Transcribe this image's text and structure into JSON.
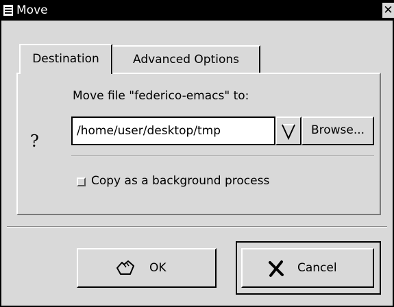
{
  "window": {
    "title": "Move"
  },
  "tabs": [
    {
      "label": "Destination"
    },
    {
      "label": "Advanced Options"
    }
  ],
  "destination": {
    "prompt": "Move file \"federico-emacs\" to:",
    "path_value": "/home/user/desktop/tmp",
    "browse_label": "Browse...",
    "background_checkbox_label": "Copy as a background process",
    "background_checked": false
  },
  "buttons": {
    "ok_label": "OK",
    "cancel_label": "Cancel"
  },
  "icons": {
    "window_menu": "window-menu-icon",
    "close": "close-icon",
    "help": "question-icon",
    "dropdown": "dropdown-arrow-icon",
    "ok": "hand-ok-icon",
    "cancel": "x-cancel-icon"
  },
  "colors": {
    "background": "#d9d9d9",
    "titlebar": "#000000",
    "field": "#ffffff"
  }
}
